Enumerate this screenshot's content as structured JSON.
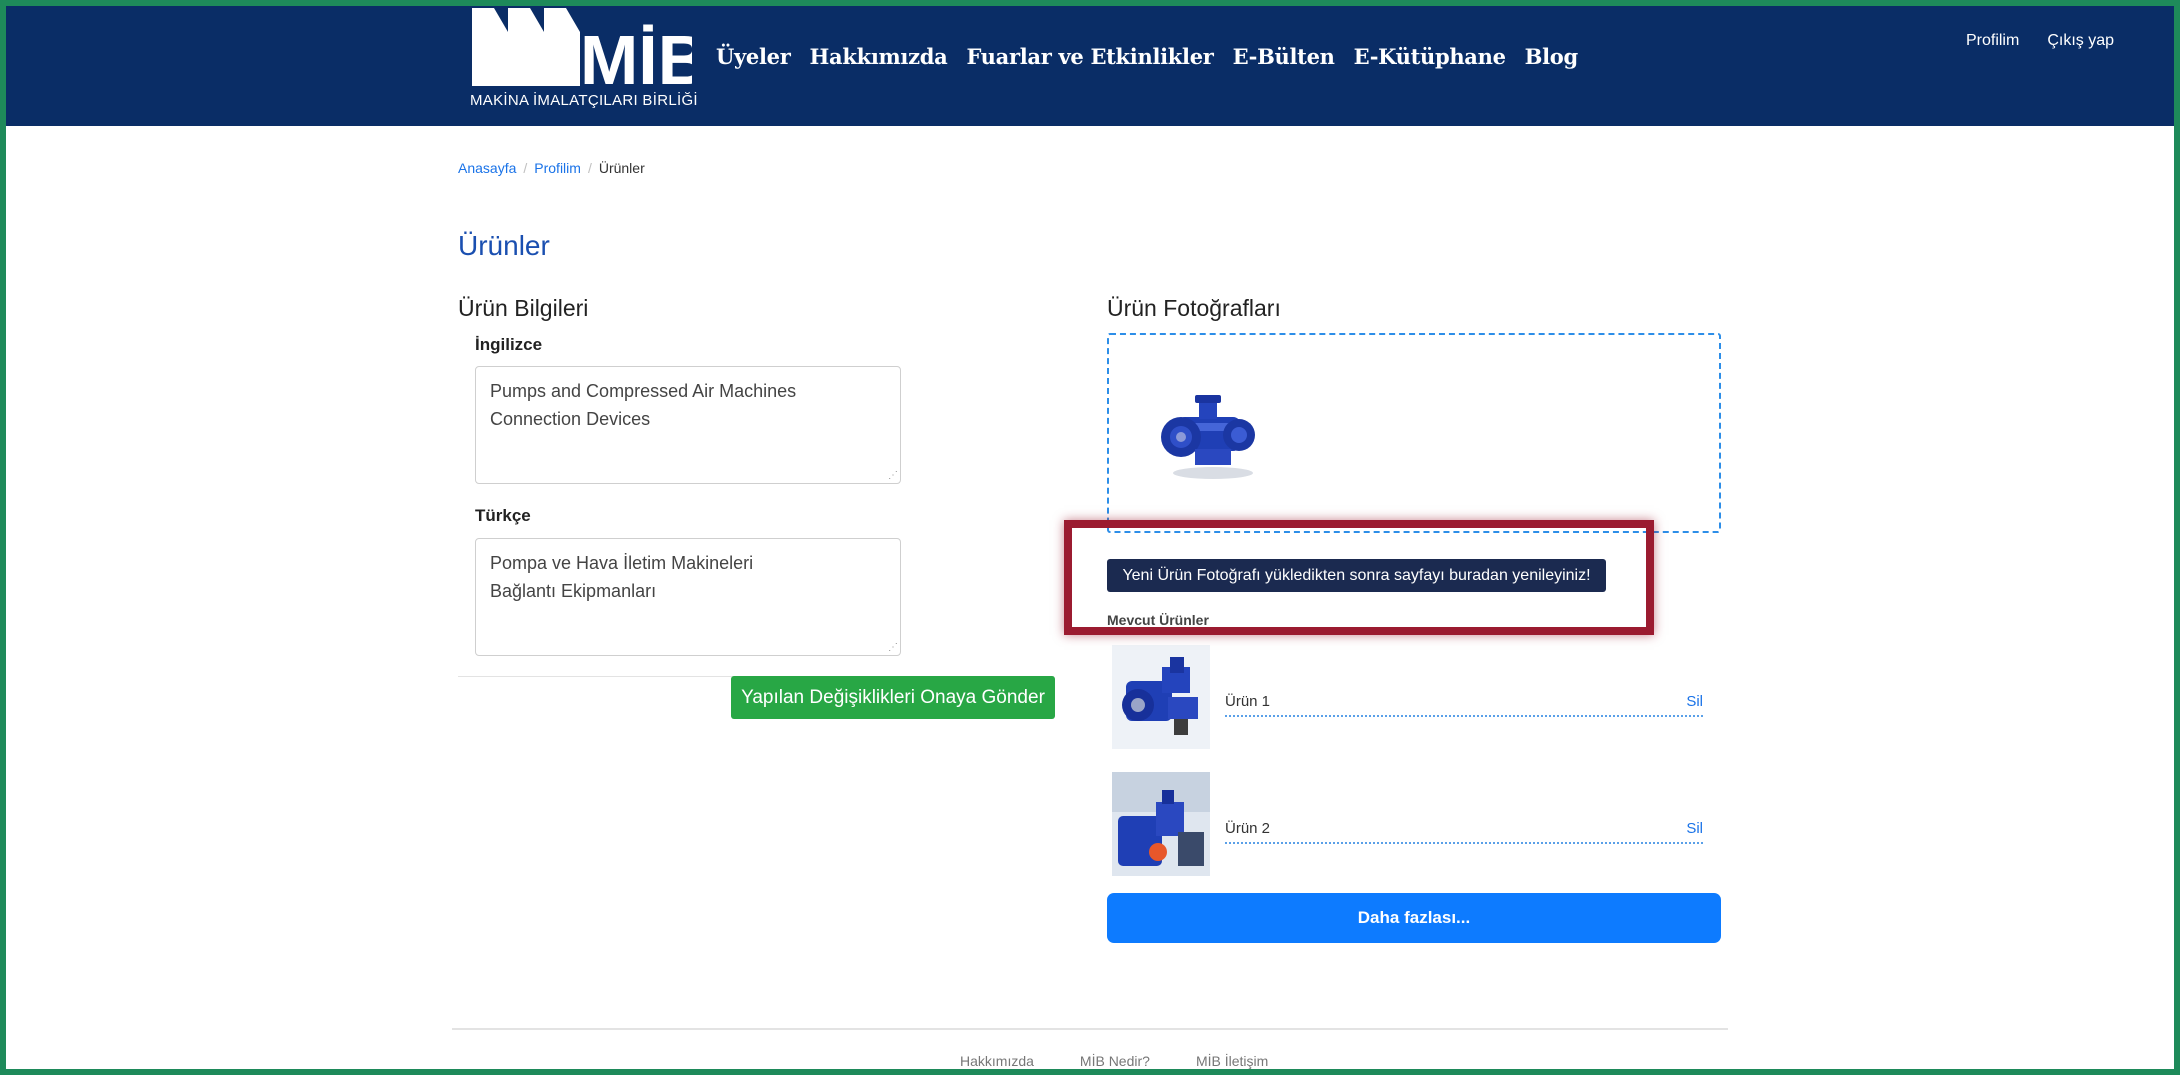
{
  "header": {
    "logo_text": "MAKİNA İMALATÇILARI BİRLİĞİ",
    "logo_wordmark": "MİB",
    "nav": [
      "Üyeler",
      "Hakkımızda",
      "Fuarlar ve Etkinlikler",
      "E-Bülten",
      "E-Kütüphane",
      "Blog"
    ],
    "user_nav": {
      "profile": "Profilim",
      "logout": "Çıkış yap"
    }
  },
  "breadcrumb": {
    "home": "Anasayfa",
    "profile": "Profilim",
    "current": "Ürünler"
  },
  "page_title": "Ürünler",
  "product_info": {
    "title": "Ürün Bilgileri",
    "english_label": "İngilizce",
    "english_value": "Pumps and Compressed Air Machines\nConnection Devices",
    "turkish_label": "Türkçe",
    "turkish_value": "Pompa ve Hava İletim Makineleri\nBağlantı Ekipmanları",
    "submit_label": "Yapılan Değişiklikleri Onaya Gönder"
  },
  "photos": {
    "title": "Ürün Fotoğrafları",
    "refresh_label": "Yeni Ürün Fotoğrafı yükledikten sonra sayfayı buradan yenileyiniz!",
    "existing_label": "Mevcut Ürünler",
    "products": [
      {
        "name": "Ürün 1",
        "delete": "Sil"
      },
      {
        "name": "Ürün 2",
        "delete": "Sil"
      }
    ],
    "more_label": "Daha fazlası..."
  },
  "footer": {
    "links": [
      "Hakkımızda",
      "MİB Nedir?",
      "MİB İletişim"
    ]
  },
  "colors": {
    "header": "#0a2d66",
    "accent": "#1a73e8",
    "success": "#28a745",
    "primary": "#0d7bff",
    "highlight": "#9b1b30"
  }
}
